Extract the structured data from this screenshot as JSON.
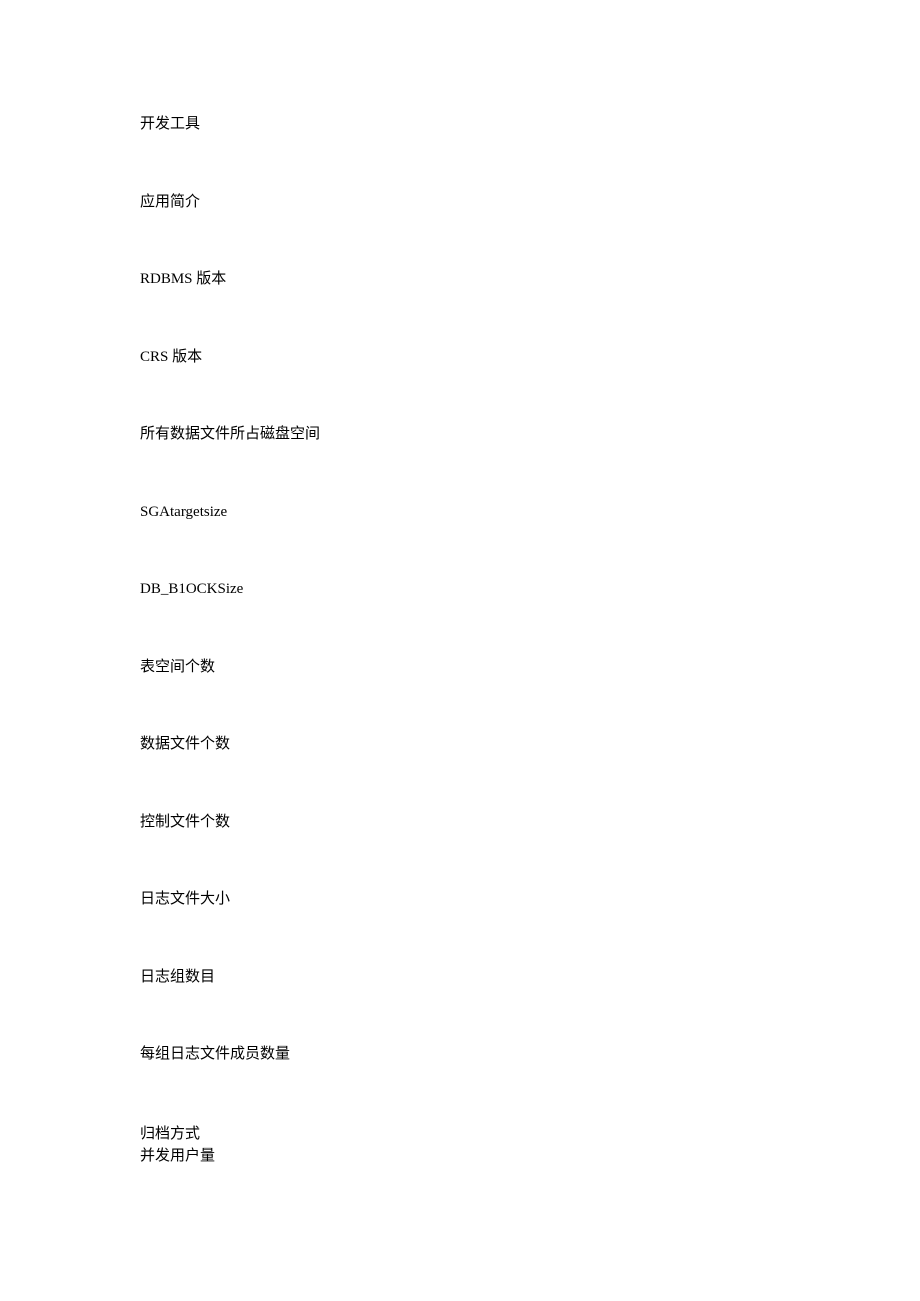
{
  "items": [
    "开发工具",
    "应用简介",
    "RDBMS 版本",
    "CRS 版本",
    "所有数据文件所占磁盘空间",
    "SGAtargetsize",
    "DB_B1OCKSize",
    "表空间个数",
    "数据文件个数",
    "控制文件个数",
    "日志文件大小",
    "日志组数目",
    "每组日志文件成员数量"
  ],
  "lastItems": [
    "归档方式",
    "并发用户量"
  ]
}
